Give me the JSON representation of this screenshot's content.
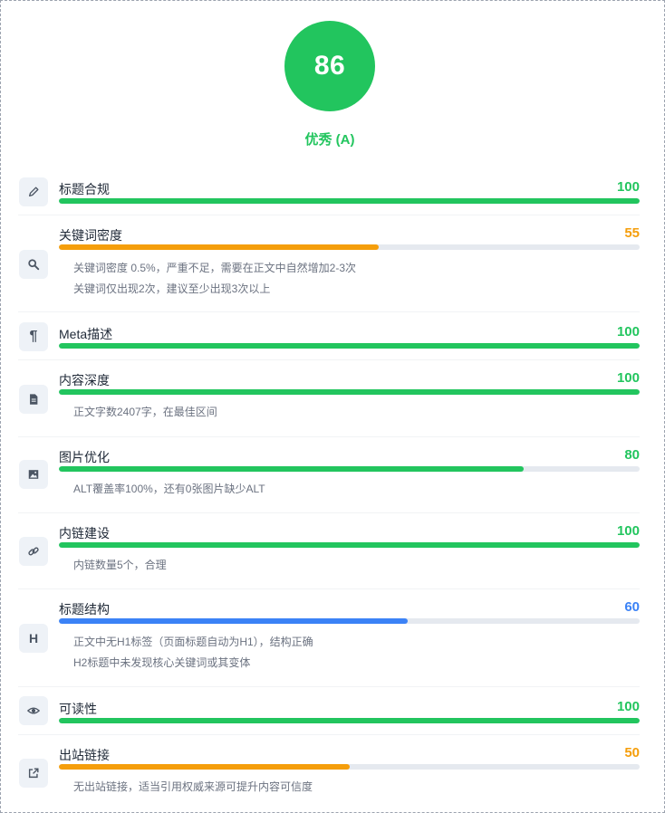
{
  "score": {
    "value": "86",
    "grade": "优秀 (A)",
    "color": "#22c55e"
  },
  "items": [
    {
      "label": "标题合规",
      "value": "100",
      "percent": 100,
      "color": "#22c55e",
      "icon": "pencil-icon",
      "notes": []
    },
    {
      "label": "关键词密度",
      "value": "55",
      "percent": 55,
      "color": "#f59e0b",
      "icon": "search-icon",
      "notes": [
        "关键词密度 0.5%，严重不足，需要在正文中自然增加2-3次",
        "关键词仅出现2次，建议至少出现3次以上"
      ]
    },
    {
      "label": "Meta描述",
      "value": "100",
      "percent": 100,
      "color": "#22c55e",
      "icon": "paragraph-icon",
      "notes": []
    },
    {
      "label": "内容深度",
      "value": "100",
      "percent": 100,
      "color": "#22c55e",
      "icon": "document-icon",
      "notes": [
        "正文字数2407字，在最佳区间"
      ]
    },
    {
      "label": "图片优化",
      "value": "80",
      "percent": 80,
      "color": "#22c55e",
      "icon": "image-icon",
      "notes": [
        "ALT覆盖率100%，还有0张图片缺少ALT"
      ]
    },
    {
      "label": "内链建设",
      "value": "100",
      "percent": 100,
      "color": "#22c55e",
      "icon": "link-icon",
      "notes": [
        "内链数量5个，合理"
      ]
    },
    {
      "label": "标题结构",
      "value": "60",
      "percent": 60,
      "color": "#3b82f6",
      "icon": "heading-icon",
      "notes": [
        "正文中无H1标签（页面标题自动为H1），结构正确",
        "H2标题中未发现核心关键词或其变体"
      ]
    },
    {
      "label": "可读性",
      "value": "100",
      "percent": 100,
      "color": "#22c55e",
      "icon": "eye-icon",
      "notes": []
    },
    {
      "label": "出站链接",
      "value": "50",
      "percent": 50,
      "color": "#f59e0b",
      "icon": "external-link-icon",
      "notes": [
        "无出站链接，适当引用权威来源可提升内容可信度"
      ]
    }
  ]
}
